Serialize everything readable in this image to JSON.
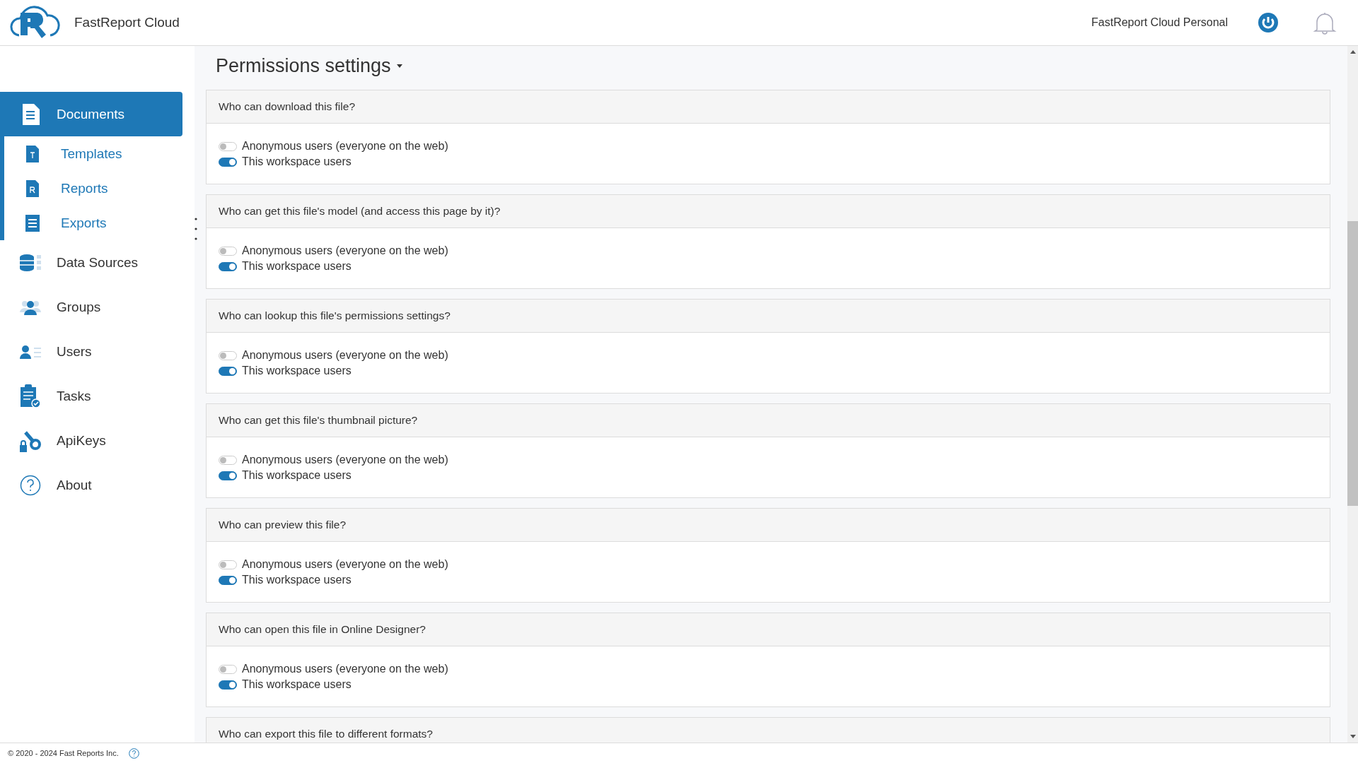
{
  "header": {
    "brand": "FastReport Cloud",
    "account": "FastReport Cloud Personal"
  },
  "sidebar": {
    "items": [
      {
        "label": "Documents",
        "selected": true,
        "children": [
          {
            "label": "Templates",
            "selected": false
          },
          {
            "label": "Reports",
            "selected": false
          },
          {
            "label": "Exports",
            "selected": false
          }
        ]
      },
      {
        "label": "Data Sources",
        "selected": false
      },
      {
        "label": "Groups",
        "selected": false
      },
      {
        "label": "Users",
        "selected": false
      },
      {
        "label": "Tasks",
        "selected": false
      },
      {
        "label": "ApiKeys",
        "selected": false
      },
      {
        "label": "About",
        "selected": false
      }
    ]
  },
  "page": {
    "title": "Permissions settings",
    "sections": [
      {
        "question": "Who can download this file?",
        "options": [
          {
            "label": "Anonymous users (everyone on the web)",
            "on": false
          },
          {
            "label": "This workspace users",
            "on": true
          }
        ]
      },
      {
        "question": "Who can get this file's model (and access this page by it)?",
        "options": [
          {
            "label": "Anonymous users (everyone on the web)",
            "on": false
          },
          {
            "label": "This workspace users",
            "on": true
          }
        ]
      },
      {
        "question": "Who can lookup this file's permissions settings?",
        "options": [
          {
            "label": "Anonymous users (everyone on the web)",
            "on": false
          },
          {
            "label": "This workspace users",
            "on": true
          }
        ]
      },
      {
        "question": "Who can get this file's thumbnail picture?",
        "options": [
          {
            "label": "Anonymous users (everyone on the web)",
            "on": false
          },
          {
            "label": "This workspace users",
            "on": true
          }
        ]
      },
      {
        "question": "Who can preview this file?",
        "options": [
          {
            "label": "Anonymous users (everyone on the web)",
            "on": false
          },
          {
            "label": "This workspace users",
            "on": true
          }
        ]
      },
      {
        "question": "Who can open this file in Online Designer?",
        "options": [
          {
            "label": "Anonymous users (everyone on the web)",
            "on": false
          },
          {
            "label": "This workspace users",
            "on": true
          }
        ]
      },
      {
        "question": "Who can export this file to different formats?"
      }
    ]
  },
  "footer": {
    "copyright": "© 2020 - 2024 Fast Reports Inc."
  }
}
